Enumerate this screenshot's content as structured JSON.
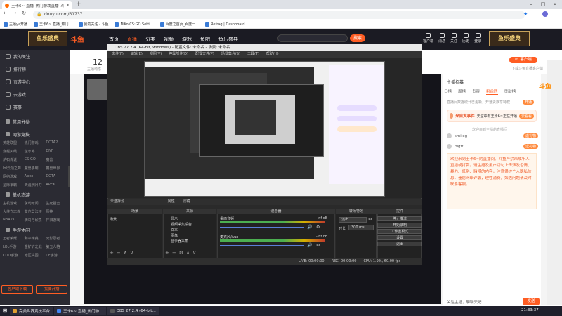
{
  "browser": {
    "tab_title": "王卡6~ 直播_热门游戏直播_斗…",
    "url": "douyu.com/61737",
    "bookmarks": [
      "主播ya开播",
      "王卡6~ 直播_热门…",
      "我的关注 - 斗鱼",
      "NiKo CS:GO Setti…",
      "百度之首页_百度一…",
      "Refrag | Dashboard"
    ]
  },
  "header": {
    "logo": "斗鱼",
    "left_banner": "鱼乐盛典",
    "right_banner": "鱼乐盛典",
    "nav": [
      "首页",
      "直播",
      "分类",
      "视频",
      "游戏",
      "鱼吧",
      "鱼乐盛典"
    ],
    "search_button": "搜索",
    "icons": [
      "客户端",
      "消息",
      "关注",
      "历史",
      "登录"
    ]
  },
  "sidebar": {
    "items": [
      "我的关注",
      "排行榜",
      "页游中心",
      "云游戏",
      "赛事"
    ],
    "section1": "常用分类",
    "section2": "网游竞技",
    "section2_games": [
      "英雄联盟",
      "热门游戏",
      "DOTA2",
      "穿越火线",
      "逆水寒",
      "DNF",
      "炉石传说",
      "CS:GO",
      "魔兽",
      "lol云顶之弈",
      "魔兽争霸",
      "魔兽世界",
      "网络游戏",
      "Apex",
      "DOTA",
      "星际争霸",
      "天涯明月刀",
      "APEX"
    ],
    "section3": "单机热游",
    "section3_games": [
      "主机游戏",
      "永劫无间",
      "生死狙击",
      "大侠立志传",
      "艾尔登法环",
      "原神",
      "NBA2K",
      "骑马与砍杀",
      "怀旧游戏"
    ],
    "section4": "手游休闲",
    "section4_games": [
      "王者荣耀",
      "和平精英",
      "火影忍者",
      "LOL手游",
      "金铲铲之战",
      "第五人格",
      "COD手游",
      "暗区突围",
      "CF手游"
    ],
    "btn_client": "客户端下载",
    "btn_open": "我要开播"
  },
  "room": {
    "count": "12",
    "sub": "主播动态",
    "pc_button": "PC客户端",
    "pc_sub": "下载斗鱼直播客户端"
  },
  "chat": {
    "host_title": "主播招募",
    "tabs": [
      "日榜",
      "周榜",
      "贵宾",
      "粉丝团",
      "贡献榜"
    ],
    "notice": "直播间数据统计已更新，开通贵族享特权",
    "notice_btn": "开通",
    "event_title": "来自大事件",
    "event_text": "天空中有王卡6~正在开播",
    "event_btn": "去看看",
    "rows": [
      {
        "name": "smileg",
        "badge": "送礼物"
      },
      {
        "name": "pigff",
        "badge": "送礼物"
      }
    ],
    "row_sub": "欢迎来到主播的直播间",
    "system_msg": "欢迎来到王卡6~的直播间。斗鱼严禁未成年人直播或打赏。请主播及用户切勿上传涉及色情、暴力、低俗、赌博的内容，注意保护个人隐私信息，谨防网络诈骗，理性消费，如遇问题请及时联系客服。",
    "input_placeholder": "关注主播，聊聊天吧",
    "send_label": "发送",
    "mascot": "斗鱼"
  },
  "obs": {
    "title": "OBS 27.2.4 (64-bit, windows) - 配置文件: 未命名 - 场景: 未命名",
    "menu": [
      "文件(F)",
      "编辑(E)",
      "视图(V)",
      "停靠部件(D)",
      "配置文件(P)",
      "场景集合(S)",
      "工具(T)",
      "帮助(H)"
    ],
    "context_bar": "未选择源",
    "context_props": "属性",
    "context_filters": "滤镜",
    "docks": [
      "场景",
      "来源",
      "混音器",
      "转场特效",
      "控件"
    ],
    "scenes": [
      "场景"
    ],
    "sources": [
      "显示",
      "视频采集设备",
      "文本",
      "图像",
      "显示器采集"
    ],
    "mixer": [
      {
        "name": "桌面音频",
        "db": "-inf dB"
      },
      {
        "name": "麦克风/Aux",
        "db": "-inf dB"
      }
    ],
    "transition": "淡出",
    "duration_label": "时长",
    "duration_value": "300 ms",
    "controls": [
      "停止推流",
      "开始录制",
      "工作室模式",
      "设置",
      "退出"
    ],
    "status": [
      "LIVE: 00:00:00",
      "REC: 00:00:00",
      "CPU: 1.9%, 60.00 fps"
    ]
  },
  "taskbar": {
    "tasks": [
      "完美世界竞技平台",
      "王卡6~ 直播_热门游…",
      "OBS 27.2.4 (64-bit…"
    ],
    "clock": "21:33:37"
  },
  "colors": {
    "accent": "#ff5d23",
    "sidebar": "#2b2b33",
    "obs_bg": "#2b2b2b"
  }
}
